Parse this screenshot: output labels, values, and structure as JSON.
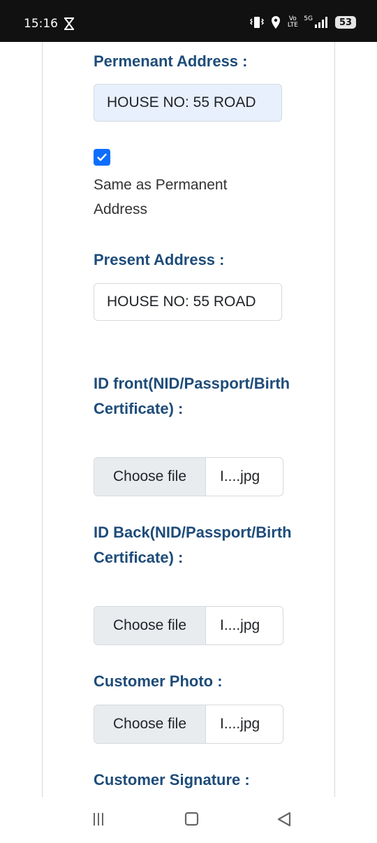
{
  "status_bar": {
    "time": "15:16",
    "network_label": "5G",
    "volte_label": "Vo LTE",
    "battery_level": "53"
  },
  "form": {
    "permanent_address": {
      "label": "Permenant Address :",
      "value": "HOUSE NO: 55 ROAD"
    },
    "same_as_permanent": {
      "checked": true,
      "label": "Same as Permanent Address"
    },
    "present_address": {
      "label": "Present Address :",
      "value": "HOUSE NO: 55 ROAD"
    },
    "id_front": {
      "label": "ID front(NID/Passport/Birth Certificate) :",
      "button": "Choose file",
      "file_name": "I....jpg"
    },
    "id_back": {
      "label": "ID Back(NID/Passport/Birth Certificate) :",
      "button": "Choose file",
      "file_name": "I....jpg"
    },
    "customer_photo": {
      "label": "Customer Photo :",
      "button": "Choose file",
      "file_name": "I....jpg"
    },
    "customer_signature": {
      "label": "Customer Signature :"
    }
  },
  "colors": {
    "label": "#1e4c7a",
    "checkbox": "#0d6efd",
    "autofill_bg": "#e8f0fe"
  },
  "icons": {
    "nav_recents": "recents-icon",
    "nav_home": "home-icon",
    "nav_back": "back-icon"
  }
}
